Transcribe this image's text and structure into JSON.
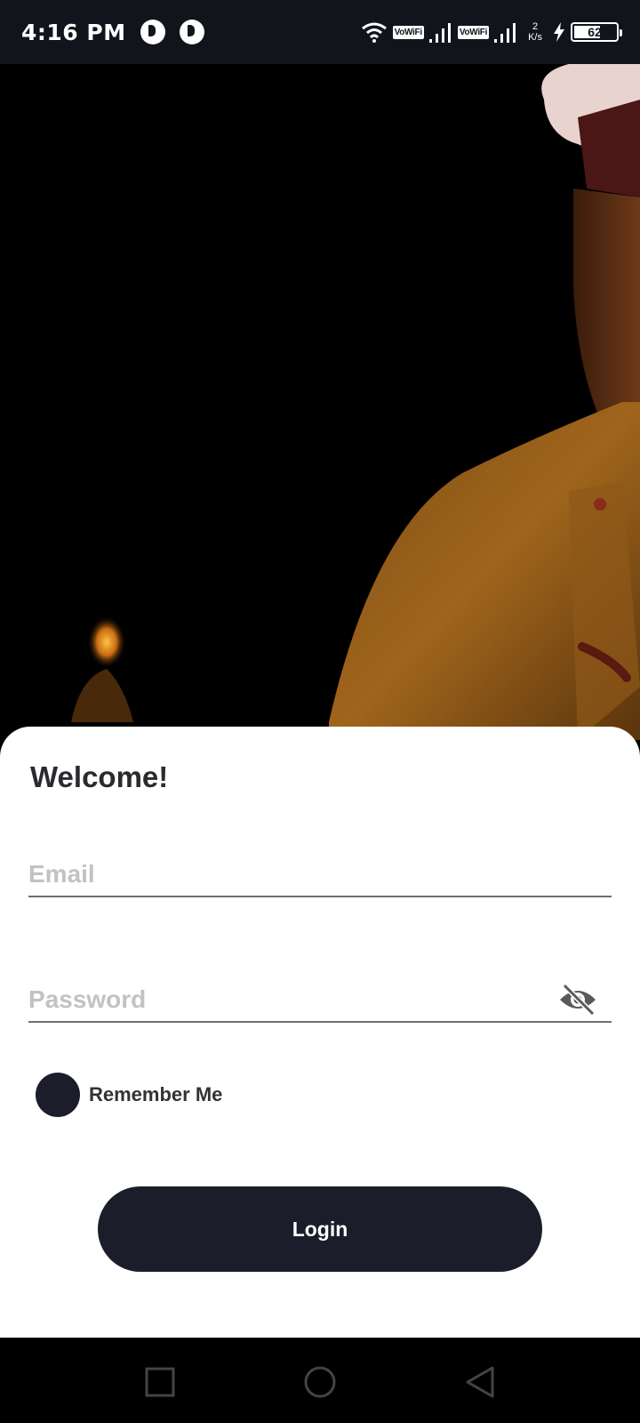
{
  "status_bar": {
    "time": "4:16 PM",
    "network_label_1": "VoWiFi",
    "network_label_2": "VoWiFi",
    "speed_value": "2",
    "speed_unit": "K/s",
    "battery_level": "62",
    "battery_fraction": 0.62,
    "icons": [
      "notification-app-icon",
      "notification-app-icon",
      "wifi-icon",
      "signal-icon",
      "signal-icon",
      "charging-bolt-icon",
      "battery-icon"
    ]
  },
  "hero": {
    "description_icon": "chef-photo"
  },
  "login": {
    "title": "Welcome!",
    "email_placeholder": "Email",
    "email_value": "",
    "password_placeholder": "Password",
    "password_value": "",
    "password_toggle_icon": "eye-off-icon",
    "remember_label": "Remember Me",
    "remember_checked": true,
    "login_label": "Login"
  },
  "nav": {
    "icons": [
      "square-recent-icon",
      "circle-home-icon",
      "triangle-back-icon"
    ]
  },
  "colors": {
    "primary": "#1b1d2b",
    "status_bar_bg": "#12141b",
    "placeholder": "#c2c2c2",
    "text_dark": "#2b2b2f"
  }
}
